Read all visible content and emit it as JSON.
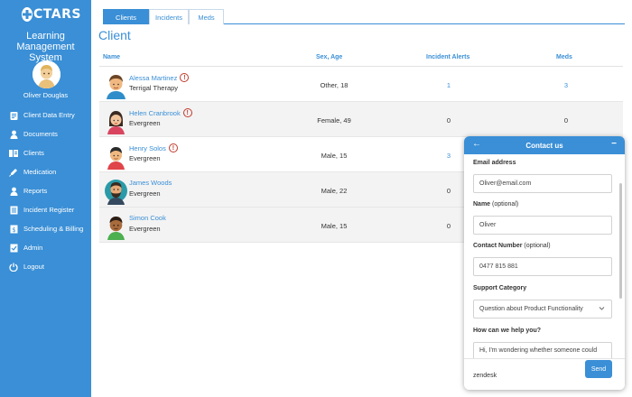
{
  "app": {
    "logo_text": "CTARS",
    "title": "Learning Management System",
    "user_name": "Oliver Douglas"
  },
  "nav": {
    "items": [
      {
        "label": "Client Data Entry",
        "icon": "clipboard-icon"
      },
      {
        "label": "Documents",
        "icon": "user-icon"
      },
      {
        "label": "Clients",
        "icon": "clients-book-icon"
      },
      {
        "label": "Medication",
        "icon": "syringe-icon"
      },
      {
        "label": "Reports",
        "icon": "user-icon"
      },
      {
        "label": "Incident Register",
        "icon": "register-icon"
      },
      {
        "label": "Scheduling & Billing",
        "icon": "billing-icon"
      },
      {
        "label": "Admin",
        "icon": "checklist-icon"
      },
      {
        "label": "Logout",
        "icon": "power-icon"
      }
    ]
  },
  "tabs": [
    {
      "label": "Clients",
      "active": true
    },
    {
      "label": "Incidents",
      "active": false
    },
    {
      "label": "Meds",
      "active": false
    }
  ],
  "page": {
    "title": "Client"
  },
  "table": {
    "headers": {
      "name": "Name",
      "sex_age": "Sex, Age",
      "incident_alerts": "Incident Alerts",
      "meds": "Meds"
    },
    "rows": [
      {
        "name": "Alessa Martinez",
        "group": "Terrigal Therapy",
        "sex_age": "Other, 18",
        "incident_alerts": "1",
        "meds": "3",
        "alert": true
      },
      {
        "name": "Helen Cranbrook",
        "group": "Evergreen",
        "sex_age": "Female, 49",
        "incident_alerts": "0",
        "meds": "0",
        "alert": true
      },
      {
        "name": "Henry Solos",
        "group": "Evergreen",
        "sex_age": "Male, 15",
        "incident_alerts": "3",
        "meds": "",
        "alert": true
      },
      {
        "name": "James Woods",
        "group": "Evergreen",
        "sex_age": "Male, 22",
        "incident_alerts": "0",
        "meds": "",
        "alert": false
      },
      {
        "name": "Simon Cook",
        "group": "Evergreen",
        "sex_age": "Male, 15",
        "incident_alerts": "0",
        "meds": "",
        "alert": false
      }
    ],
    "alert_glyph": "!"
  },
  "contact": {
    "title": "Contact us",
    "back_glyph": "←",
    "minimize_glyph": "−",
    "email_label": "Email address",
    "email_value": "Oliver@email.com",
    "name_label": "Name",
    "name_optional": "(optional)",
    "name_value": "Oliver",
    "phone_label": "Contact Number",
    "phone_optional": "(optional)",
    "phone_value": "0477 815 881",
    "category_label": "Support Category",
    "category_value": "Question about Product Functionality",
    "help_label": "How can we help you?",
    "help_value": "Hi, I'm wondering whether someone could",
    "footer_brand": "zendesk",
    "send_label": "Send"
  },
  "colors": {
    "primary": "#3a8fd6",
    "alert": "#c0392b"
  }
}
